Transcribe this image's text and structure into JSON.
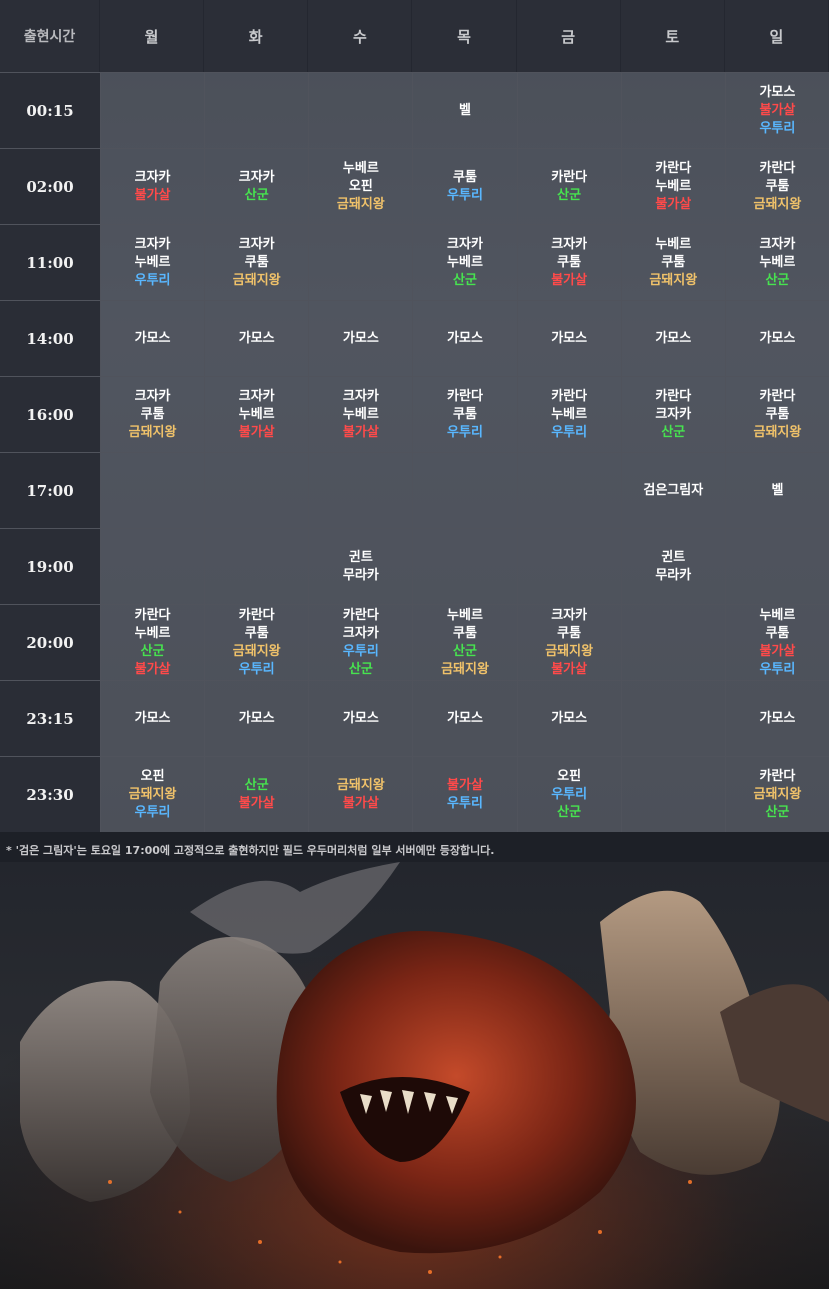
{
  "header": [
    "출현시간",
    "월",
    "화",
    "수",
    "목",
    "금",
    "토",
    "일"
  ],
  "rows": [
    {
      "time": "00:15",
      "cells": [
        [],
        [],
        [],
        [
          {
            "t": "벨",
            "c": "w"
          }
        ],
        [],
        [],
        [
          {
            "t": "가모스",
            "c": "w"
          },
          {
            "t": "불가살",
            "c": "r"
          },
          {
            "t": "우투리",
            "c": "b"
          }
        ]
      ]
    },
    {
      "time": "02:00",
      "cells": [
        [
          {
            "t": "크자카",
            "c": "w"
          },
          {
            "t": "불가살",
            "c": "r"
          }
        ],
        [
          {
            "t": "크자카",
            "c": "w"
          },
          {
            "t": "산군",
            "c": "g"
          }
        ],
        [
          {
            "t": "누베르",
            "c": "w"
          },
          {
            "t": "오핀",
            "c": "w"
          },
          {
            "t": "금돼지왕",
            "c": "y"
          }
        ],
        [
          {
            "t": "쿠툼",
            "c": "w"
          },
          {
            "t": "우투리",
            "c": "b"
          }
        ],
        [
          {
            "t": "카란다",
            "c": "w"
          },
          {
            "t": "산군",
            "c": "g"
          }
        ],
        [
          {
            "t": "카란다",
            "c": "w"
          },
          {
            "t": "누베르",
            "c": "w"
          },
          {
            "t": "불가살",
            "c": "r"
          }
        ],
        [
          {
            "t": "카란다",
            "c": "w"
          },
          {
            "t": "쿠툼",
            "c": "w"
          },
          {
            "t": "금돼지왕",
            "c": "y"
          }
        ]
      ]
    },
    {
      "time": "11:00",
      "cells": [
        [
          {
            "t": "크자카",
            "c": "w"
          },
          {
            "t": "누베르",
            "c": "w"
          },
          {
            "t": "우투리",
            "c": "b"
          }
        ],
        [
          {
            "t": "크자카",
            "c": "w"
          },
          {
            "t": "쿠툼",
            "c": "w"
          },
          {
            "t": "금돼지왕",
            "c": "y"
          }
        ],
        [],
        [
          {
            "t": "크자카",
            "c": "w"
          },
          {
            "t": "누베르",
            "c": "w"
          },
          {
            "t": "산군",
            "c": "g"
          }
        ],
        [
          {
            "t": "크자카",
            "c": "w"
          },
          {
            "t": "쿠툼",
            "c": "w"
          },
          {
            "t": "불가살",
            "c": "r"
          }
        ],
        [
          {
            "t": "누베르",
            "c": "w"
          },
          {
            "t": "쿠툼",
            "c": "w"
          },
          {
            "t": "금돼지왕",
            "c": "y"
          }
        ],
        [
          {
            "t": "크자카",
            "c": "w"
          },
          {
            "t": "누베르",
            "c": "w"
          },
          {
            "t": "산군",
            "c": "g"
          }
        ]
      ]
    },
    {
      "time": "14:00",
      "cells": [
        [
          {
            "t": "가모스",
            "c": "w"
          }
        ],
        [
          {
            "t": "가모스",
            "c": "w"
          }
        ],
        [
          {
            "t": "가모스",
            "c": "w"
          }
        ],
        [
          {
            "t": "가모스",
            "c": "w"
          }
        ],
        [
          {
            "t": "가모스",
            "c": "w"
          }
        ],
        [
          {
            "t": "가모스",
            "c": "w"
          }
        ],
        [
          {
            "t": "가모스",
            "c": "w"
          }
        ]
      ]
    },
    {
      "time": "16:00",
      "cells": [
        [
          {
            "t": "크자카",
            "c": "w"
          },
          {
            "t": "쿠툼",
            "c": "w"
          },
          {
            "t": "금돼지왕",
            "c": "y"
          }
        ],
        [
          {
            "t": "크자카",
            "c": "w"
          },
          {
            "t": "누베르",
            "c": "w"
          },
          {
            "t": "불가살",
            "c": "r"
          }
        ],
        [
          {
            "t": "크자카",
            "c": "w"
          },
          {
            "t": "누베르",
            "c": "w"
          },
          {
            "t": "불가살",
            "c": "r"
          }
        ],
        [
          {
            "t": "카란다",
            "c": "w"
          },
          {
            "t": "쿠툼",
            "c": "w"
          },
          {
            "t": "우투리",
            "c": "b"
          }
        ],
        [
          {
            "t": "카란다",
            "c": "w"
          },
          {
            "t": "누베르",
            "c": "w"
          },
          {
            "t": "우투리",
            "c": "b"
          }
        ],
        [
          {
            "t": "카란다",
            "c": "w"
          },
          {
            "t": "크자카",
            "c": "w"
          },
          {
            "t": "산군",
            "c": "g"
          }
        ],
        [
          {
            "t": "카란다",
            "c": "w"
          },
          {
            "t": "쿠툼",
            "c": "w"
          },
          {
            "t": "금돼지왕",
            "c": "y"
          }
        ]
      ]
    },
    {
      "time": "17:00",
      "cells": [
        [],
        [],
        [],
        [],
        [],
        [
          {
            "t": "검은그림자",
            "c": "w"
          }
        ],
        [
          {
            "t": "벨",
            "c": "w"
          }
        ]
      ]
    },
    {
      "time": "19:00",
      "cells": [
        [],
        [],
        [
          {
            "t": "귄트",
            "c": "w"
          },
          {
            "t": "무라카",
            "c": "w"
          }
        ],
        [],
        [],
        [
          {
            "t": "귄트",
            "c": "w"
          },
          {
            "t": "무라카",
            "c": "w"
          }
        ],
        []
      ]
    },
    {
      "time": "20:00",
      "cells": [
        [
          {
            "t": "카란다",
            "c": "w"
          },
          {
            "t": "누베르",
            "c": "w"
          },
          {
            "t": "산군",
            "c": "g"
          },
          {
            "t": "불가살",
            "c": "r"
          }
        ],
        [
          {
            "t": "카란다",
            "c": "w"
          },
          {
            "t": "쿠툼",
            "c": "w"
          },
          {
            "t": "금돼지왕",
            "c": "y"
          },
          {
            "t": "우투리",
            "c": "b"
          }
        ],
        [
          {
            "t": "카란다",
            "c": "w"
          },
          {
            "t": "크자카",
            "c": "w"
          },
          {
            "t": "우투리",
            "c": "b"
          },
          {
            "t": "산군",
            "c": "g"
          }
        ],
        [
          {
            "t": "누베르",
            "c": "w"
          },
          {
            "t": "쿠툼",
            "c": "w"
          },
          {
            "t": "산군",
            "c": "g"
          },
          {
            "t": "금돼지왕",
            "c": "y"
          }
        ],
        [
          {
            "t": "크자카",
            "c": "w"
          },
          {
            "t": "쿠툼",
            "c": "w"
          },
          {
            "t": "금돼지왕",
            "c": "y"
          },
          {
            "t": "불가살",
            "c": "r"
          }
        ],
        [],
        [
          {
            "t": "누베르",
            "c": "w"
          },
          {
            "t": "쿠툼",
            "c": "w"
          },
          {
            "t": "불가살",
            "c": "r"
          },
          {
            "t": "우투리",
            "c": "b"
          }
        ]
      ]
    },
    {
      "time": "23:15",
      "cells": [
        [
          {
            "t": "가모스",
            "c": "w"
          }
        ],
        [
          {
            "t": "가모스",
            "c": "w"
          }
        ],
        [
          {
            "t": "가모스",
            "c": "w"
          }
        ],
        [
          {
            "t": "가모스",
            "c": "w"
          }
        ],
        [
          {
            "t": "가모스",
            "c": "w"
          }
        ],
        [],
        [
          {
            "t": "가모스",
            "c": "w"
          }
        ]
      ]
    },
    {
      "time": "23:30",
      "cells": [
        [
          {
            "t": "오핀",
            "c": "w"
          },
          {
            "t": "금돼지왕",
            "c": "y"
          },
          {
            "t": "우투리",
            "c": "b"
          }
        ],
        [
          {
            "t": "산군",
            "c": "g"
          },
          {
            "t": "불가살",
            "c": "r"
          }
        ],
        [
          {
            "t": "금돼지왕",
            "c": "y"
          },
          {
            "t": "불가살",
            "c": "r"
          }
        ],
        [
          {
            "t": "불가살",
            "c": "r"
          },
          {
            "t": "우투리",
            "c": "b"
          }
        ],
        [
          {
            "t": "오핀",
            "c": "w"
          },
          {
            "t": "우투리",
            "c": "b"
          },
          {
            "t": "산군",
            "c": "g"
          }
        ],
        [],
        [
          {
            "t": "카란다",
            "c": "w"
          },
          {
            "t": "금돼지왕",
            "c": "y"
          },
          {
            "t": "산군",
            "c": "g"
          }
        ]
      ]
    }
  ],
  "note": "*  '검은 그림자'는 토요일 17:00에 고정적으로 출현하지만 필드 우두머리처럼 일부 서버에만 등장합니다.",
  "colors": {
    "w": "#ffffff",
    "r": "#ff4a4a",
    "g": "#47e34f",
    "b": "#59b7ff",
    "y": "#f0c26a"
  }
}
